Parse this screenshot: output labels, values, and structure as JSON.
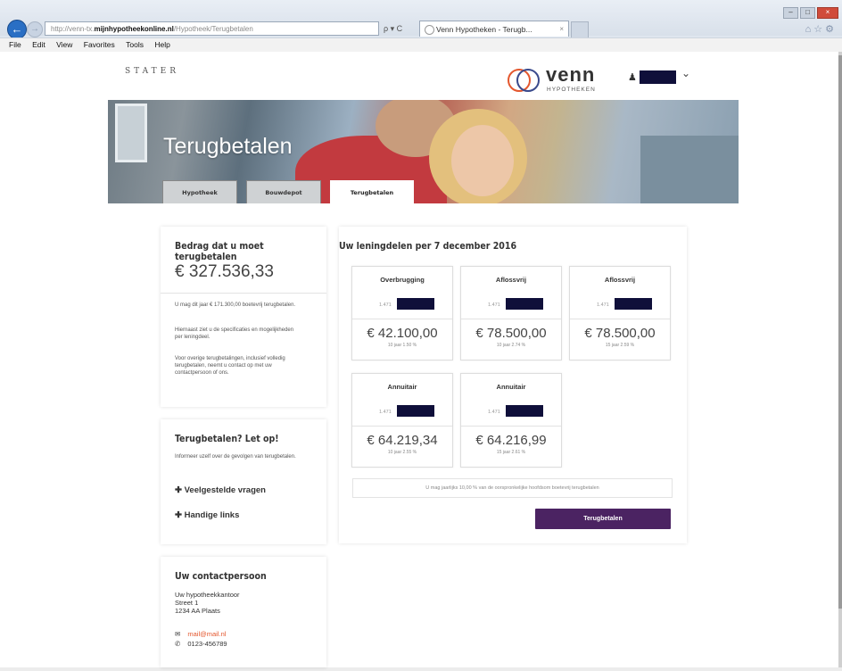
{
  "browser": {
    "url_prefix": "http://venn-tx.",
    "url_domain": "mijnhypotheekonline.nl",
    "url_path": "/Hypotheek/Terugbetalen",
    "addr_tools": "ρ ▾ C",
    "tab_title": "Venn Hypotheken - Terugb...",
    "menu": [
      "File",
      "Edit",
      "View",
      "Favorites",
      "Tools",
      "Help"
    ]
  },
  "header": {
    "stater_logo": "STATER",
    "venn_word": "venn",
    "venn_sub": "HYPOTHEKEN"
  },
  "hero": {
    "title": "Terugbetalen",
    "tabs": [
      "Hypotheek",
      "Bouwdepot",
      "Terugbetalen"
    ],
    "active_tab": 2
  },
  "summary": {
    "heading": "Bedrag dat u moet terugbetalen",
    "amount": "€ 327.536,33",
    "p1": "U mag dit jaar € 171.300,00 boetevrij terugbetalen.",
    "p2": "Hiernaast ziet u de specificaties en mogelijkheden per leningdeel.",
    "p3": "Voor overige terugbetalingen, inclusief volledig terugbetalen, neemt u contact op met uw contactpersoon of ons."
  },
  "attention": {
    "heading": "Terugbetalen? Let op!",
    "text": "Informeer uzelf over de gevolgen van terugbetalen.",
    "links": [
      "Veelgestelde vragen",
      "Handige links"
    ]
  },
  "contact": {
    "heading": "Uw contactpersoon",
    "office": "Uw hypotheekkantoor",
    "street": "Street 1",
    "city": "1234 AA Plaats",
    "email": "mail@mail.nl",
    "phone": "0123-456789"
  },
  "loans": {
    "heading": "Uw leningdelen per 7 december 2016",
    "cards": [
      {
        "type": "Overbrugging",
        "acc_prefix": "1.471",
        "amount": "€ 42.100,00",
        "sub": "10 jaar 1.50 %"
      },
      {
        "type": "Aflossvrij",
        "acc_prefix": "1.471",
        "amount": "€ 78.500,00",
        "sub": "10 jaar 2.74 %"
      },
      {
        "type": "Aflossvrij",
        "acc_prefix": "1.471",
        "amount": "€ 78.500,00",
        "sub": "15 jaar 2.59 %"
      },
      {
        "type": "Annuitair",
        "acc_prefix": "1.471",
        "amount": "€ 64.219,34",
        "sub": "10 jaar 2.55 %"
      },
      {
        "type": "Annuitair",
        "acc_prefix": "1.471",
        "amount": "€ 64.216,99",
        "sub": "15 jaar 2.61 %"
      }
    ],
    "note": "U mag jaarlijks 10,00 % van de oorspronkelijke hoofdsom boetevrij terugbetalen",
    "button": "Terugbetalen"
  },
  "colors": {
    "accent": "#4b2362",
    "redacted": "#0f0f3a",
    "email_link": "#e4572e"
  }
}
